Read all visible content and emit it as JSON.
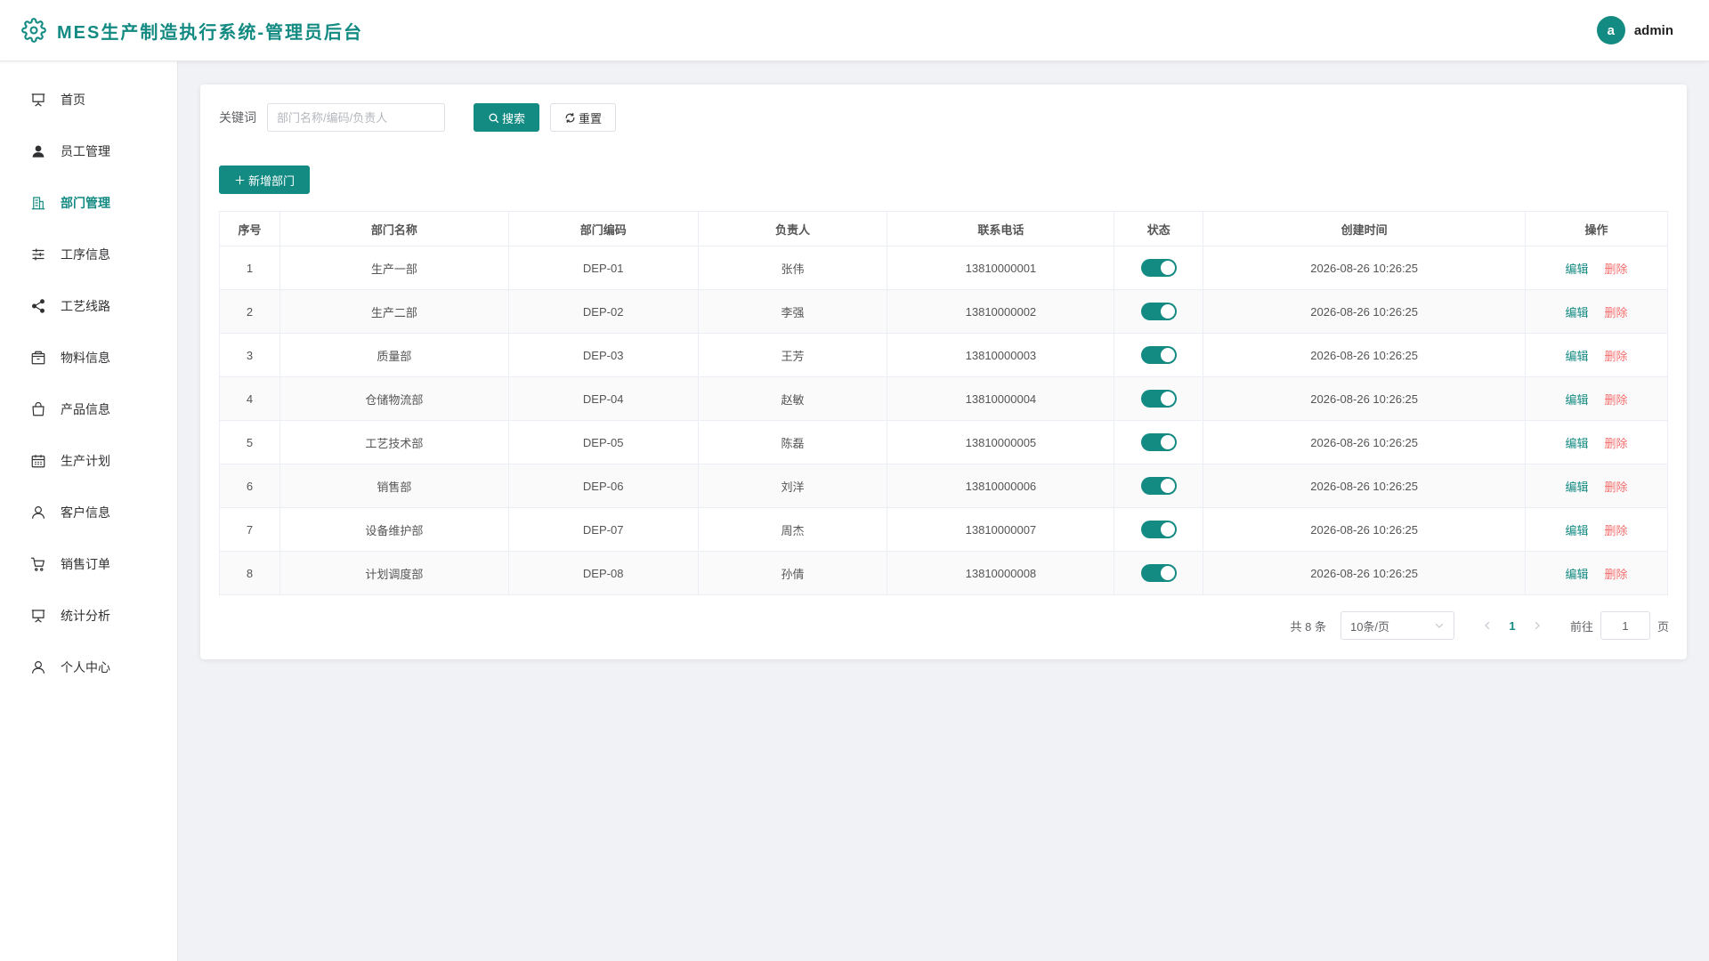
{
  "header": {
    "title": "MES生产制造执行系统-管理员后台",
    "avatar_letter": "a",
    "username": "admin",
    "logo_icon": "gear-icon"
  },
  "colors": {
    "accent": "#138a82",
    "danger": "#f56c6c",
    "text": "#333333",
    "muted": "#606266"
  },
  "sidebar": {
    "items": [
      {
        "label": "首页",
        "icon": "presentation-icon"
      },
      {
        "label": "员工管理",
        "icon": "user-filled-icon"
      },
      {
        "label": "部门管理",
        "icon": "office-building-icon",
        "active": true
      },
      {
        "label": "工序信息",
        "icon": "sliders-icon"
      },
      {
        "label": "工艺线路",
        "icon": "share-icon"
      },
      {
        "label": "物料信息",
        "icon": "box-icon"
      },
      {
        "label": "产品信息",
        "icon": "shopping-bag-icon"
      },
      {
        "label": "生产计划",
        "icon": "calendar-icon"
      },
      {
        "label": "客户信息",
        "icon": "user-icon"
      },
      {
        "label": "销售订单",
        "icon": "shopping-cart-icon"
      },
      {
        "label": "统计分析",
        "icon": "presentation-icon"
      },
      {
        "label": "个人中心",
        "icon": "user-icon"
      }
    ]
  },
  "search": {
    "label": "关键词",
    "placeholder": "部门名称/编码/负责人",
    "value": "",
    "search_button": "搜索",
    "reset_button": "重置"
  },
  "toolbar": {
    "add_button": "新增部门"
  },
  "table": {
    "columns": [
      "序号",
      "部门名称",
      "部门编码",
      "负责人",
      "联系电话",
      "状态",
      "创建时间",
      "操作"
    ],
    "rows": [
      {
        "index": "1",
        "name": "生产一部",
        "code": "DEP-01",
        "manager": "张伟",
        "phone": "13810000001",
        "enabled": true,
        "created": "2026-08-26 10:26:25"
      },
      {
        "index": "2",
        "name": "生产二部",
        "code": "DEP-02",
        "manager": "李强",
        "phone": "13810000002",
        "enabled": true,
        "created": "2026-08-26 10:26:25"
      },
      {
        "index": "3",
        "name": "质量部",
        "code": "DEP-03",
        "manager": "王芳",
        "phone": "13810000003",
        "enabled": true,
        "created": "2026-08-26 10:26:25"
      },
      {
        "index": "4",
        "name": "仓储物流部",
        "code": "DEP-04",
        "manager": "赵敏",
        "phone": "13810000004",
        "enabled": true,
        "created": "2026-08-26 10:26:25"
      },
      {
        "index": "5",
        "name": "工艺技术部",
        "code": "DEP-05",
        "manager": "陈磊",
        "phone": "13810000005",
        "enabled": true,
        "created": "2026-08-26 10:26:25"
      },
      {
        "index": "6",
        "name": "销售部",
        "code": "DEP-06",
        "manager": "刘洋",
        "phone": "13810000006",
        "enabled": true,
        "created": "2026-08-26 10:26:25"
      },
      {
        "index": "7",
        "name": "设备维护部",
        "code": "DEP-07",
        "manager": "周杰",
        "phone": "13810000007",
        "enabled": true,
        "created": "2026-08-26 10:26:25"
      },
      {
        "index": "8",
        "name": "计划调度部",
        "code": "DEP-08",
        "manager": "孙倩",
        "phone": "13810000008",
        "enabled": true,
        "created": "2026-08-26 10:26:25"
      }
    ],
    "edit_label": "编辑",
    "delete_label": "删除"
  },
  "pagination": {
    "total_text": "共 8 条",
    "page_size": "10条/页",
    "current_page": "1",
    "goto_label": "前往",
    "goto_value": "1",
    "goto_suffix": "页"
  }
}
